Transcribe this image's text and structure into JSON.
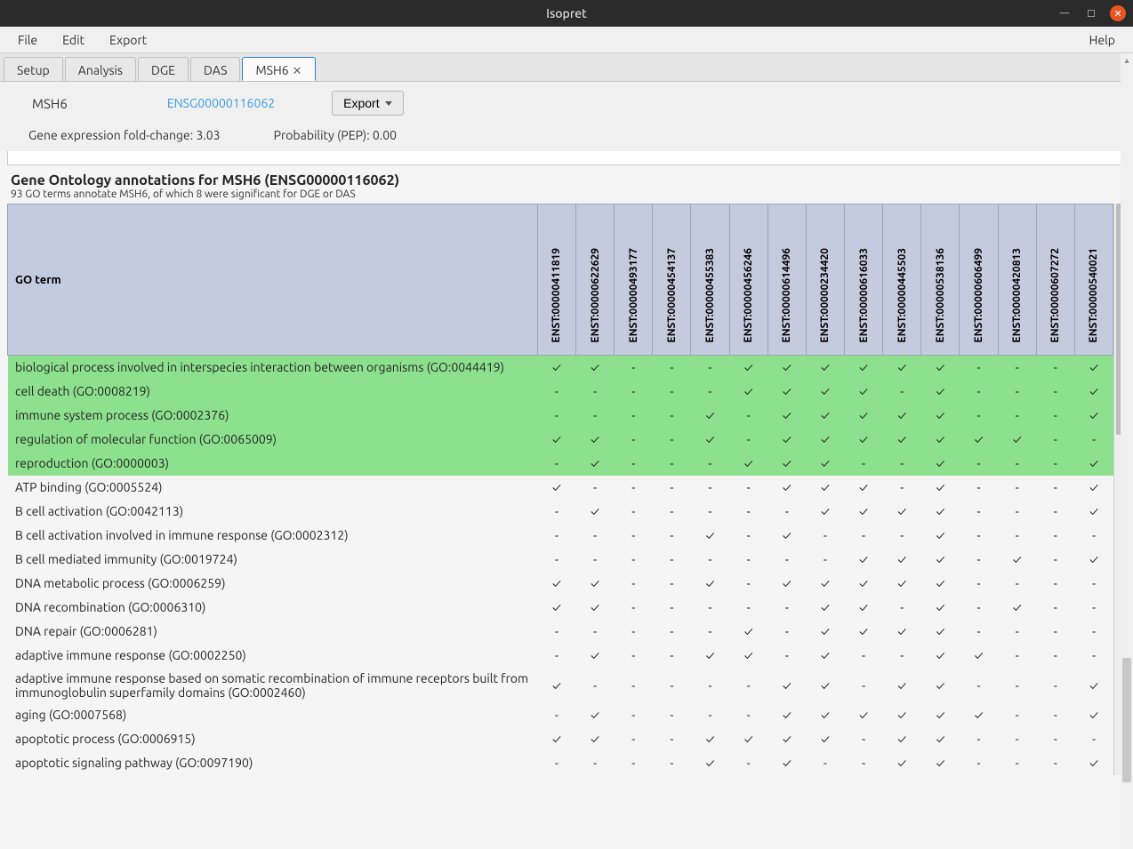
{
  "titlebar": {
    "title": "Isopret"
  },
  "menubar": {
    "items": [
      "File",
      "Edit",
      "Export"
    ],
    "help": "Help"
  },
  "tabs": {
    "items": [
      "Setup",
      "Analysis",
      "DGE",
      "DAS"
    ],
    "active_label": "MSH6",
    "close_glyph": "✕"
  },
  "gene": {
    "name": "MSH6",
    "ensembl_id": "ENSG00000116062",
    "export_label": "Export",
    "fold_change_label": "Gene expression fold-change: 3.03",
    "pep_label": "Probability (PEP): 0.00"
  },
  "section": {
    "title": "Gene Ontology annotations for MSH6 (ENSG00000116062)",
    "subtitle": "93 GO terms annotate MSH6, of which 8 were significant for DGE or DAS"
  },
  "table": {
    "go_header": "GO term",
    "enst_cols": [
      "ENST:00000411819",
      "ENST:00000622629",
      "ENST:00000493177",
      "ENST:00000454137",
      "ENST:00000455383",
      "ENST:00000456246",
      "ENST:00000614496",
      "ENST:00000234420",
      "ENST:00000616033",
      "ENST:00000445503",
      "ENST:00000538136",
      "ENST:00000606499",
      "ENST:00000420813",
      "ENST:00000607272",
      "ENST:00000540021"
    ],
    "rows": [
      {
        "sig": true,
        "term": "biological process involved in interspecies interaction between organisms (GO:0044419)",
        "m": [
          1,
          1,
          0,
          0,
          0,
          1,
          1,
          1,
          1,
          1,
          1,
          0,
          0,
          0,
          1
        ]
      },
      {
        "sig": true,
        "term": "cell death (GO:0008219)",
        "m": [
          0,
          0,
          0,
          0,
          0,
          1,
          1,
          1,
          1,
          0,
          1,
          0,
          0,
          0,
          1
        ]
      },
      {
        "sig": true,
        "term": "immune system process (GO:0002376)",
        "m": [
          0,
          0,
          0,
          0,
          1,
          0,
          1,
          1,
          1,
          1,
          1,
          0,
          0,
          0,
          1
        ]
      },
      {
        "sig": true,
        "term": "regulation of molecular function (GO:0065009)",
        "m": [
          1,
          1,
          0,
          0,
          1,
          0,
          1,
          1,
          1,
          1,
          1,
          1,
          1,
          0,
          0
        ]
      },
      {
        "sig": true,
        "term": "reproduction (GO:0000003)",
        "m": [
          0,
          1,
          0,
          0,
          0,
          1,
          1,
          1,
          0,
          0,
          1,
          0,
          0,
          0,
          1
        ]
      },
      {
        "sig": false,
        "term": "ATP binding (GO:0005524)",
        "m": [
          1,
          0,
          0,
          0,
          0,
          0,
          1,
          1,
          1,
          0,
          1,
          0,
          0,
          0,
          1
        ]
      },
      {
        "sig": false,
        "term": "B cell activation (GO:0042113)",
        "m": [
          0,
          1,
          0,
          0,
          0,
          0,
          0,
          1,
          1,
          1,
          1,
          0,
          0,
          0,
          1
        ]
      },
      {
        "sig": false,
        "term": "B cell activation involved in immune response (GO:0002312)",
        "m": [
          0,
          0,
          0,
          0,
          1,
          0,
          1,
          0,
          0,
          0,
          1,
          0,
          0,
          0,
          0
        ]
      },
      {
        "sig": false,
        "term": "B cell mediated immunity (GO:0019724)",
        "m": [
          0,
          0,
          0,
          0,
          0,
          0,
          0,
          0,
          1,
          1,
          1,
          0,
          1,
          0,
          1
        ]
      },
      {
        "sig": false,
        "term": "DNA metabolic process (GO:0006259)",
        "m": [
          1,
          1,
          0,
          0,
          1,
          0,
          1,
          1,
          1,
          1,
          1,
          0,
          0,
          0,
          0
        ]
      },
      {
        "sig": false,
        "term": "DNA recombination (GO:0006310)",
        "m": [
          1,
          1,
          0,
          0,
          0,
          0,
          0,
          1,
          1,
          0,
          1,
          0,
          1,
          0,
          0
        ]
      },
      {
        "sig": false,
        "term": "DNA repair (GO:0006281)",
        "m": [
          0,
          0,
          0,
          0,
          0,
          1,
          0,
          1,
          1,
          1,
          1,
          0,
          0,
          0,
          0
        ]
      },
      {
        "sig": false,
        "term": "adaptive immune response (GO:0002250)",
        "m": [
          0,
          1,
          0,
          0,
          1,
          1,
          0,
          1,
          0,
          0,
          1,
          1,
          0,
          0,
          0
        ]
      },
      {
        "sig": false,
        "term": "adaptive immune response based on somatic recombination of immune receptors built from immunoglobulin superfamily domains (GO:0002460)",
        "m": [
          1,
          0,
          0,
          0,
          0,
          0,
          1,
          1,
          0,
          1,
          1,
          0,
          0,
          0,
          1
        ]
      },
      {
        "sig": false,
        "term": "aging (GO:0007568)",
        "m": [
          0,
          1,
          0,
          0,
          0,
          0,
          1,
          1,
          1,
          1,
          1,
          1,
          0,
          0,
          1
        ]
      },
      {
        "sig": false,
        "term": "apoptotic process (GO:0006915)",
        "m": [
          1,
          1,
          0,
          0,
          1,
          1,
          1,
          1,
          0,
          1,
          1,
          0,
          0,
          0,
          0
        ]
      },
      {
        "sig": false,
        "term": "apoptotic signaling pathway (GO:0097190)",
        "m": [
          0,
          0,
          0,
          0,
          1,
          0,
          1,
          0,
          0,
          1,
          1,
          0,
          0,
          0,
          1
        ]
      }
    ]
  }
}
